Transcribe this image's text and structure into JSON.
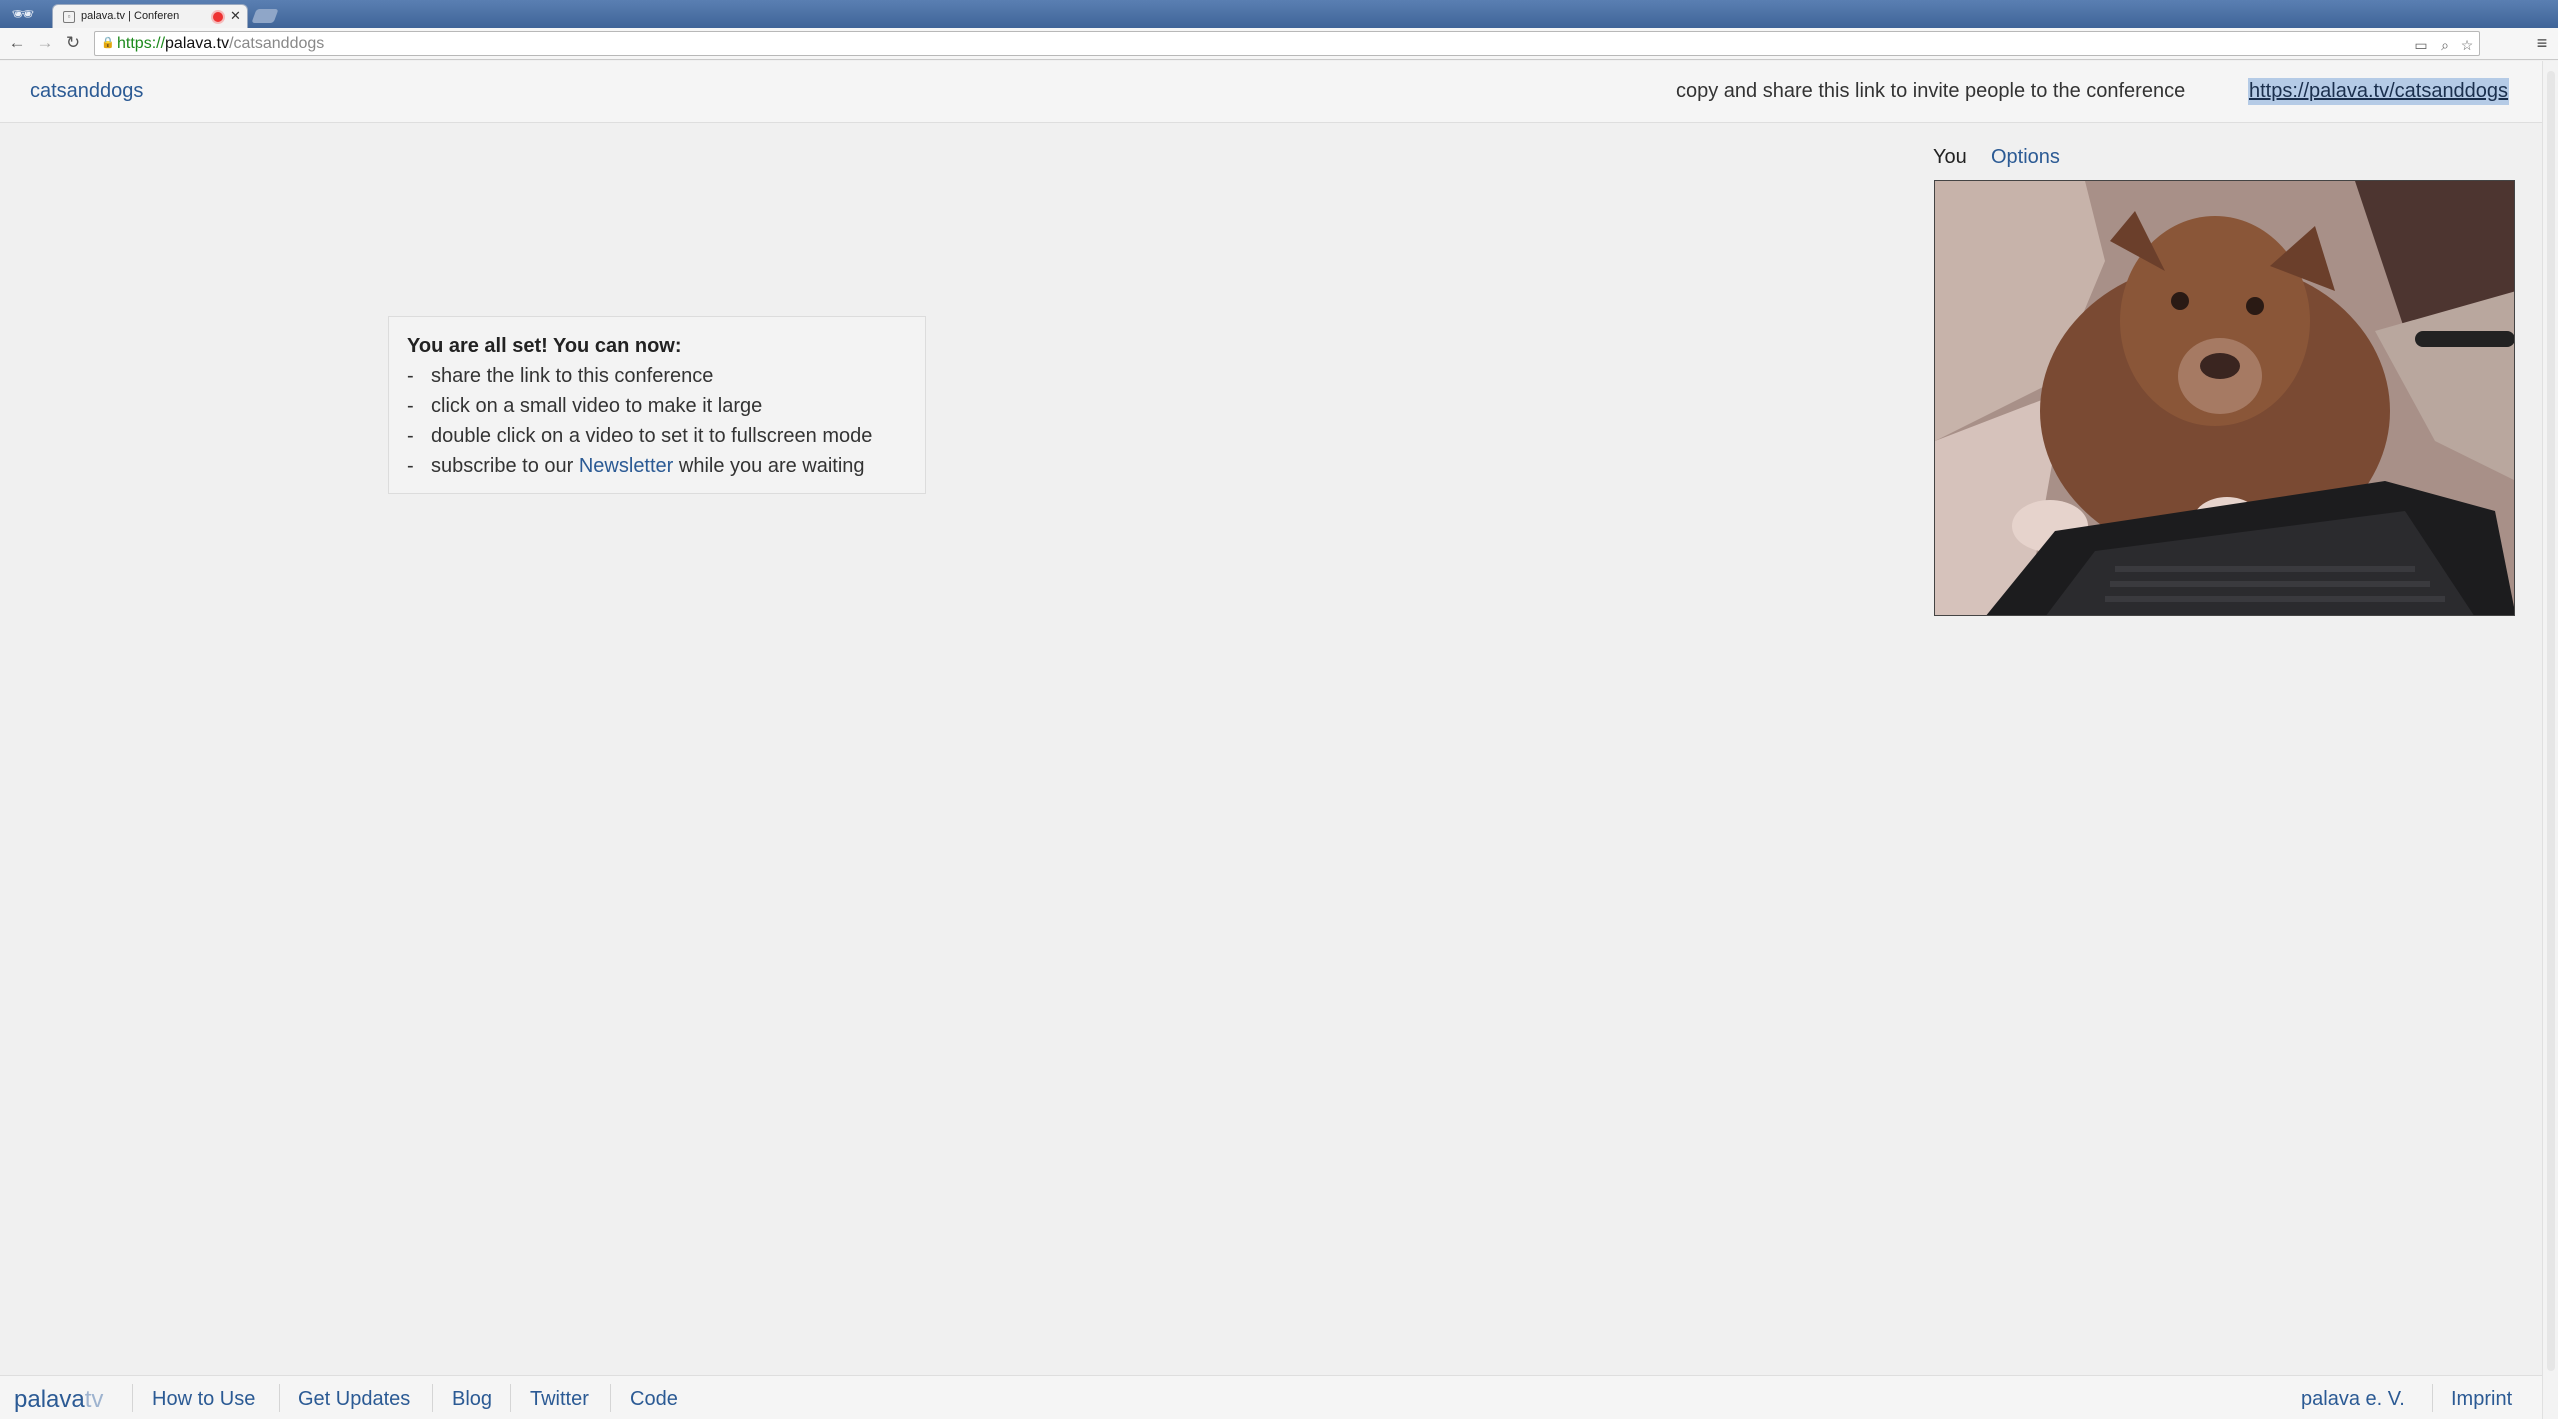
{
  "browser": {
    "tab_title": "palava.tv | Conferen",
    "url_scheme": "https://",
    "url_host": "palava.tv",
    "url_path": "/catsanddogs",
    "icons": [
      "back-icon",
      "forward-icon",
      "reload-icon",
      "lock-icon",
      "cast-icon",
      "zoom-icon",
      "star-icon",
      "menu-icon"
    ]
  },
  "header": {
    "room_name": "catsanddogs",
    "invite_hint": "copy and share this link to invite people to the conference",
    "invite_link": "https://palava.tv/catsanddogs"
  },
  "info": {
    "title": "You are all set! You can now:",
    "items": [
      "share the link to this conference",
      "click on a small video to make it large",
      "double click on a video to set it to fullscreen mode"
    ],
    "newsletter_prefix": "subscribe to our ",
    "newsletter_link": "Newsletter",
    "newsletter_suffix": " while you are waiting",
    "dash": "-"
  },
  "video": {
    "you_label": "You",
    "options_label": "Options"
  },
  "footer": {
    "logo_main": "palava",
    "logo_tv": "tv",
    "links": [
      "How to Use",
      "Get Updates",
      "Blog",
      "Twitter",
      "Code"
    ],
    "right_links": [
      "palava e. V.",
      "Imprint"
    ]
  },
  "colors": {
    "link": "#2b5a94",
    "tabbar": "#4a6fa5",
    "background": "#f0f0f0",
    "selection": "#b5cbe6"
  }
}
